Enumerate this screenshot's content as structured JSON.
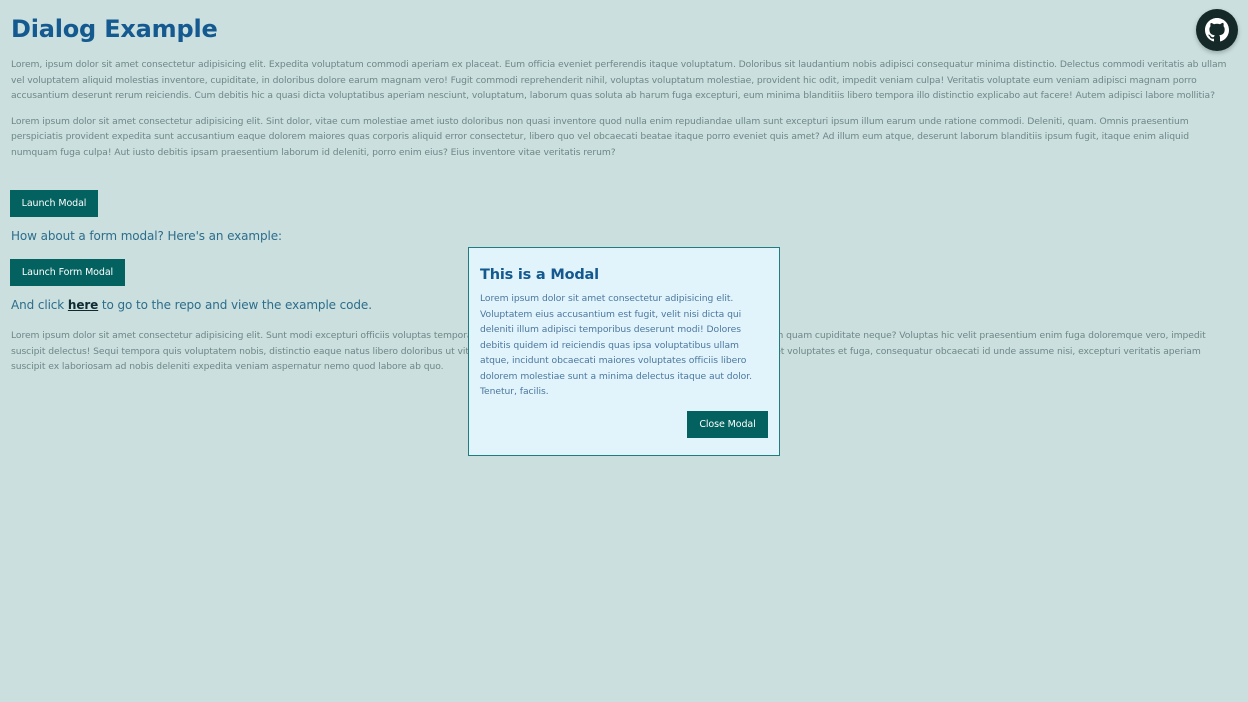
{
  "page": {
    "title": "Dialog Example",
    "paragraphs": [
      "Lorem, ipsum dolor sit amet consectetur adipisicing elit. Expedita voluptatum commodi aperiam ex placeat. Eum officia eveniet perferendis itaque voluptatum. Doloribus sit laudantium nobis adipisci consequatur minima distinctio. Delectus commodi veritatis ab ullam vel voluptatem aliquid molestias inventore, cupiditate, in doloribus dolore earum magnam vero! Fugit commodi reprehenderit nihil, voluptas voluptatum molestiae, provident hic odit, impedit veniam culpa! Veritatis voluptate eum veniam adipisci magnam porro accusantium deserunt rerum reiciendis. Cum debitis hic a quasi dicta voluptatibus aperiam nesciunt, voluptatum, laborum quas soluta ab harum fuga excepturi, eum minima blanditiis libero tempora illo distinctio explicabo aut facere! Autem adipisci labore mollitia?",
      "Lorem ipsum dolor sit amet consectetur adipisicing elit. Sint dolor, vitae cum molestiae amet iusto doloribus non quasi inventore quod nulla enim repudiandae ullam sunt excepturi ipsum illum earum unde ratione commodi. Deleniti, quam. Omnis praesentium perspiciatis provident expedita sunt accusantium eaque dolorem maiores quas corporis aliquid error consectetur, libero quo vel obcaecati beatae itaque porro eveniet quis amet? Ad illum eum atque, deserunt laborum blanditiis ipsum fugit, itaque enim aliquid numquam fuga culpa! Aut iusto debitis ipsam praesentium laborum id deleniti, porro enim eius? Eius inventore vitae veritatis rerum?",
      "Lorem ipsum dolor sit amet consectetur adipisicing elit. Sunt modi excepturi officiis voluptas tempora iste nihil assumenda similique quisquam quae reiciendis, numquam quam cupiditate neque? Voluptas hic velit praesentium enim fuga doloremque vero, impedit suscipit delectus! Sequi tempora quis voluptatem nobis, distinctio eaque natus libero doloribus ut vitae nulla provident cupiditate iste minus aspernatur. Blanditiis eveniet voluptates et fuga, consequatur obcaecati id unde assume nisi, excepturi veritatis aperiam suscipit ex laboriosam ad nobis deleniti expedita veniam aspernatur nemo quod labore ab quo."
    ],
    "launch_modal_label": "Launch Modal",
    "form_modal_prompt": "How about a form modal? Here's an example:",
    "launch_form_modal_label": "Launch Form Modal",
    "repo_prefix": "And click ",
    "repo_link": "here",
    "repo_suffix": " to go to the repo and view the example code."
  },
  "github_button": {
    "icon": "github-icon"
  },
  "modal": {
    "title": "This is a Modal",
    "body": "Lorem ipsum dolor sit amet consectetur adipisicing elit. Voluptatem eius accusantium est fugit, velit nisi dicta qui deleniti illum adipisci temporibus deserunt modi! Dolores debitis quidem id reiciendis quas ipsa voluptatibus ullam atque, incidunt obcaecati maiores voluptates officiis libero dolorem molestiae sunt a minima delectus itaque aut dolor. Tenetur, facilis.",
    "close_label": "Close Modal"
  },
  "colors": {
    "background": "#cadfde",
    "title": "#14598f",
    "button": "#03625f",
    "modal_background": "#e1f4fb",
    "modal_border": "#1f7d82",
    "github_button": "#152a28"
  }
}
